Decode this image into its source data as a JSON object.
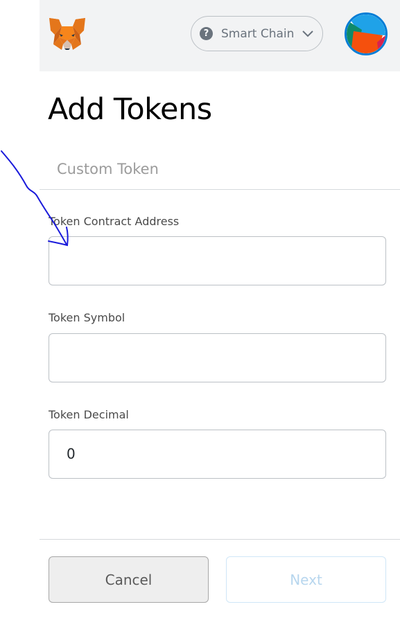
{
  "header": {
    "logo": "metamask-fox-icon",
    "network": {
      "label": "Smart Chain",
      "icon": "question-circle-icon"
    },
    "account_avatar": "account-identicon"
  },
  "page": {
    "title": "Add Tokens",
    "tab_label": "Custom Token"
  },
  "form": {
    "contract_address": {
      "label": "Token Contract Address",
      "value": ""
    },
    "symbol": {
      "label": "Token Symbol",
      "value": ""
    },
    "decimal": {
      "label": "Token Decimal",
      "value": "0"
    }
  },
  "actions": {
    "cancel_label": "Cancel",
    "next_label": "Next"
  },
  "colors": {
    "topbar_bg": "#f2f3f4",
    "accent_blue": "#037dd6",
    "annotation_arrow": "#1a1adb"
  }
}
